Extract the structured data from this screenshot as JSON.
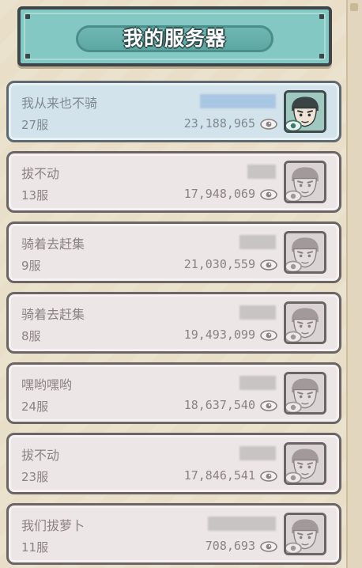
{
  "header": {
    "title": "我的服务器"
  },
  "servers": [
    {
      "name": "我从来也不骑",
      "server": "27服",
      "power": "23,188,965",
      "selected": true,
      "blur_width": 96
    },
    {
      "name": "拔不动",
      "server": "13服",
      "power": "17,948,069",
      "selected": false,
      "blur_width": 36
    },
    {
      "name": "骑着去赶集",
      "server": "9服",
      "power": "21,030,559",
      "selected": false,
      "blur_width": 46
    },
    {
      "name": "骑着去赶集",
      "server": "8服",
      "power": "19,493,099",
      "selected": false,
      "blur_width": 46
    },
    {
      "name": "嘿哟嘿哟",
      "server": "24服",
      "power": "18,637,540",
      "selected": false,
      "blur_width": 46
    },
    {
      "name": "拔不动",
      "server": "23服",
      "power": "17,846,541",
      "selected": false,
      "blur_width": 46
    },
    {
      "name": "我们拔萝卜",
      "server": "11服",
      "power": "708,693",
      "selected": false,
      "blur_width": 86
    }
  ],
  "icons": {
    "eye": "eye-icon",
    "avatar": "hero-avatar-icon"
  },
  "colors": {
    "banner": "#84c8c3",
    "selected_card": "#d3e3ec",
    "card": "#ece6e6"
  }
}
